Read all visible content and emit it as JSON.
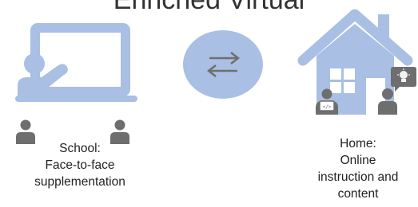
{
  "title": "Enriched Virtual",
  "colors": {
    "accent": "#a9bfe3",
    "person": "#6e6e6e",
    "bulb": "#f2f2f2",
    "text": "#222222"
  },
  "icons": {
    "board": "classroom-board-icon",
    "exchange": "exchange-arrows-icon",
    "house": "house-icon",
    "person": "person-icon",
    "laptop": "laptop-icon",
    "bulb": "lightbulb-icon"
  },
  "school": {
    "line1": "School:",
    "line2": "Face-to-face",
    "line3": "supplementation"
  },
  "home": {
    "line1": "Home:",
    "line2": "Online",
    "line3": "instruction and",
    "line4": "content"
  }
}
